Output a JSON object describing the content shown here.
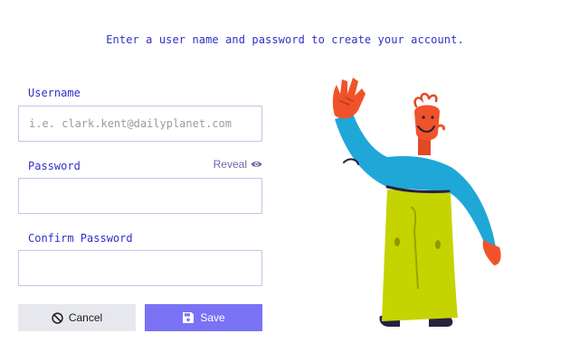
{
  "form": {
    "instructions": "Enter a user name and password to create your account.",
    "username": {
      "label": "Username",
      "value": "",
      "placeholder": "i.e. clark.kent@dailyplanet.com"
    },
    "password": {
      "label": "Password",
      "value": "",
      "placeholder": "",
      "reveal_label": "Reveal",
      "reveal_icon": "eye-icon"
    },
    "confirm_password": {
      "label": "Confirm Password",
      "value": "",
      "placeholder": ""
    }
  },
  "actions": {
    "cancel_label": "Cancel",
    "cancel_icon": "ban-icon",
    "save_label": "Save",
    "save_icon": "floppy-disk-icon"
  },
  "colors": {
    "accent": "#7a72f5",
    "label_text": "#2f2fc9",
    "input_border": "#c4c4e6",
    "cancel_bg": "#e7e8ee"
  },
  "illustration": {
    "name": "waving-person-illustration"
  }
}
